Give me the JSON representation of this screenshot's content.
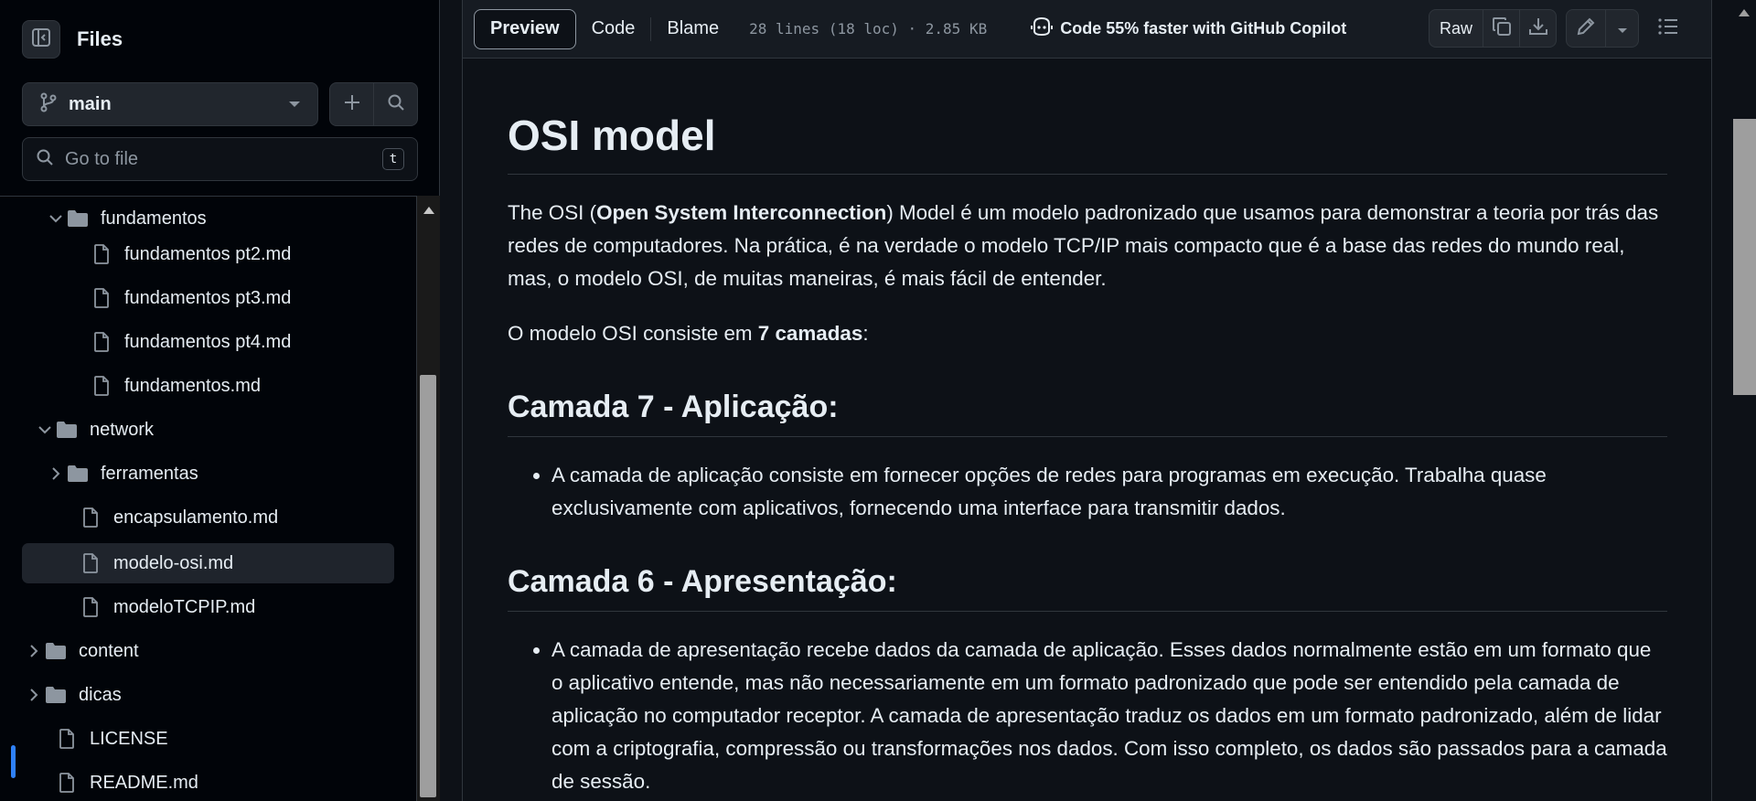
{
  "sidebar": {
    "title": "Files",
    "branch": "main",
    "goto_placeholder": "Go to file",
    "goto_shortcut": "t",
    "tree": [
      {
        "label": "fundamentos",
        "type": "folder",
        "expanded": true
      },
      {
        "label": "fundamentos pt2.md",
        "type": "file"
      },
      {
        "label": "fundamentos pt3.md",
        "type": "file"
      },
      {
        "label": "fundamentos pt4.md",
        "type": "file"
      },
      {
        "label": "fundamentos.md",
        "type": "file"
      },
      {
        "label": "network",
        "type": "folder",
        "expanded": true
      },
      {
        "label": "ferramentas",
        "type": "folder",
        "expanded": false
      },
      {
        "label": "encapsulamento.md",
        "type": "file"
      },
      {
        "label": "modelo-osi.md",
        "type": "file",
        "active": true
      },
      {
        "label": "modeloTCPIP.md",
        "type": "file"
      },
      {
        "label": "content",
        "type": "folder",
        "expanded": false
      },
      {
        "label": "dicas",
        "type": "folder",
        "expanded": false
      },
      {
        "label": "LICENSE",
        "type": "file"
      },
      {
        "label": "README.md",
        "type": "file"
      }
    ]
  },
  "toolbar": {
    "tabs": [
      "Preview",
      "Code",
      "Blame"
    ],
    "selected_tab": "Preview",
    "meta": "28 lines (18 loc) · 2.85 KB",
    "copilot": "Code 55% faster with GitHub Copilot",
    "raw": "Raw"
  },
  "article": {
    "title": "OSI model",
    "intro_pre": "The OSI (",
    "intro_bold": "Open System Interconnection",
    "intro_post": ") Model é um modelo padronizado que usamos para demonstrar a teoria por trás das redes de computadores. Na prática, é na verdade o modelo TCP/IP mais compacto que é a base das redes do mundo real, mas, o modelo OSI, de muitas maneiras, é mais fácil de entender.",
    "layers_pre": "O modelo OSI consiste em ",
    "layers_bold": "7 camadas",
    "layers_post": ":",
    "sections": [
      {
        "heading": "Camada 7 - Aplicação:",
        "item": "A camada de aplicação consiste em fornecer opções de redes para programas em execução. Trabalha quase exclusivamente com aplicativos, fornecendo uma interface para transmitir dados."
      },
      {
        "heading": "Camada 6 - Apresentação:",
        "item": "A camada de apresentação recebe dados da camada de aplicação. Esses dados normalmente estão em um formato que o aplicativo entende, mas não necessariamente em um formato padronizado que pode ser entendido pela camada de aplicação no computador receptor. A camada de apresentação traduz os dados em um formato padronizado, além de lidar com a criptografia, compressão ou transformações nos dados. Com isso completo, os dados são passados para a camada de sessão."
      }
    ]
  },
  "colors": {
    "background": "#0d1117",
    "sidebar_bg": "#010409",
    "border": "#30363d",
    "accent": "#2f81f7",
    "muted": "#8d96a0"
  }
}
